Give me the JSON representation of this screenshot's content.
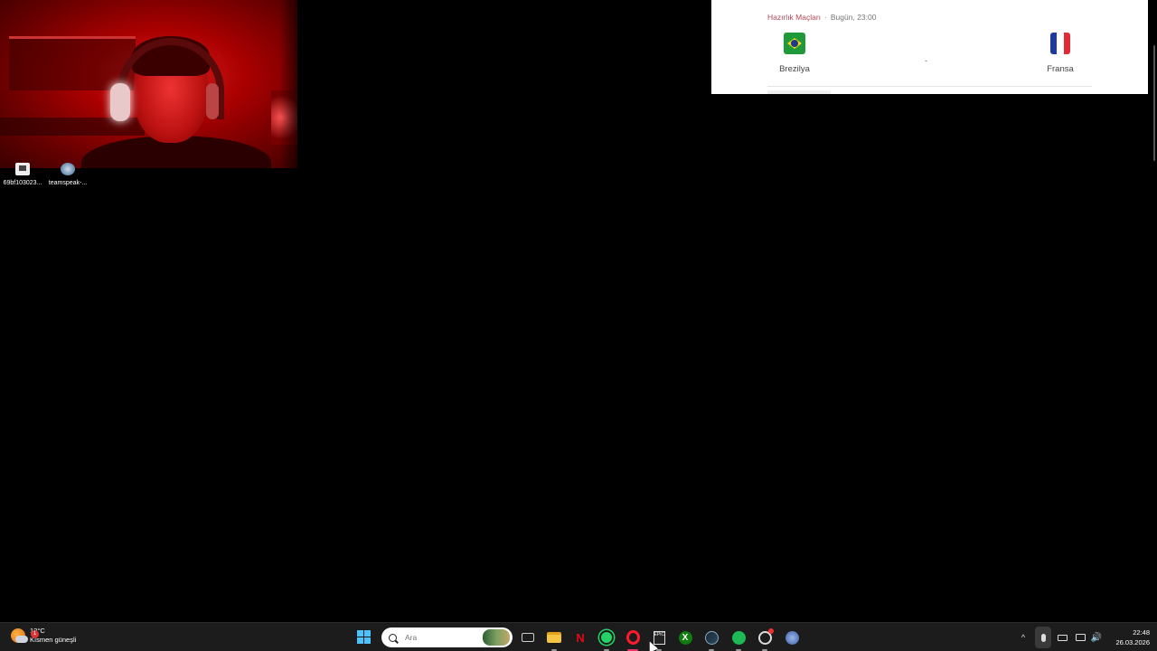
{
  "desktop": {
    "icons": [
      {
        "label": "69bf103023...",
        "icon": "file-icon"
      },
      {
        "label": "teamspeak-...",
        "icon": "teamspeak-icon"
      }
    ]
  },
  "match_card": {
    "league": "Hazırlık Maçları",
    "separator": "·",
    "time": "Bugün, 23:00",
    "home_team": "Brezilya",
    "away_team": "Fransa",
    "score": "-",
    "colors": {
      "league": "#b5485a"
    }
  },
  "taskbar": {
    "weather": {
      "temp": "12°C",
      "condition": "Kısmen güneşli",
      "badge": "1"
    },
    "search": {
      "placeholder": "Ara"
    },
    "apps": [
      "start",
      "search",
      "task-view",
      "file-explorer",
      "netflix",
      "whatsapp",
      "opera-gx",
      "epic-games",
      "xbox",
      "steam",
      "spotify",
      "chatgpt",
      "teamspeak"
    ],
    "netflix_glyph": "N",
    "epic_glyph": "EPIC",
    "xbox_glyph": "X",
    "tray": {
      "chevron": "^",
      "volume": "🔊"
    },
    "clock": {
      "time": "22:48",
      "date": "26.03.2026"
    }
  }
}
